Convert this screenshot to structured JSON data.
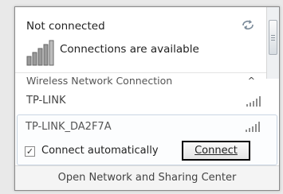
{
  "status": {
    "title": "Not connected",
    "available_text": "Connections are available"
  },
  "section": {
    "label": "Wireless Network Connection"
  },
  "networks": [
    {
      "name": "TP-LINK",
      "signal_icon": "signal-bars-icon"
    },
    {
      "name": "TP-LINK_DA2F7A",
      "signal_icon": "signal-bars-icon"
    }
  ],
  "selected_network": {
    "auto_connect_label": "Connect automatically",
    "auto_connect_checked": true,
    "connect_label": "Connect",
    "checkmark": "✓"
  },
  "footer": {
    "link_text": "Open Network and Sharing Center"
  },
  "icons": {
    "refresh": "refresh-icon",
    "collapse": "chevron-up-icon",
    "chevron_glyph": "^"
  }
}
